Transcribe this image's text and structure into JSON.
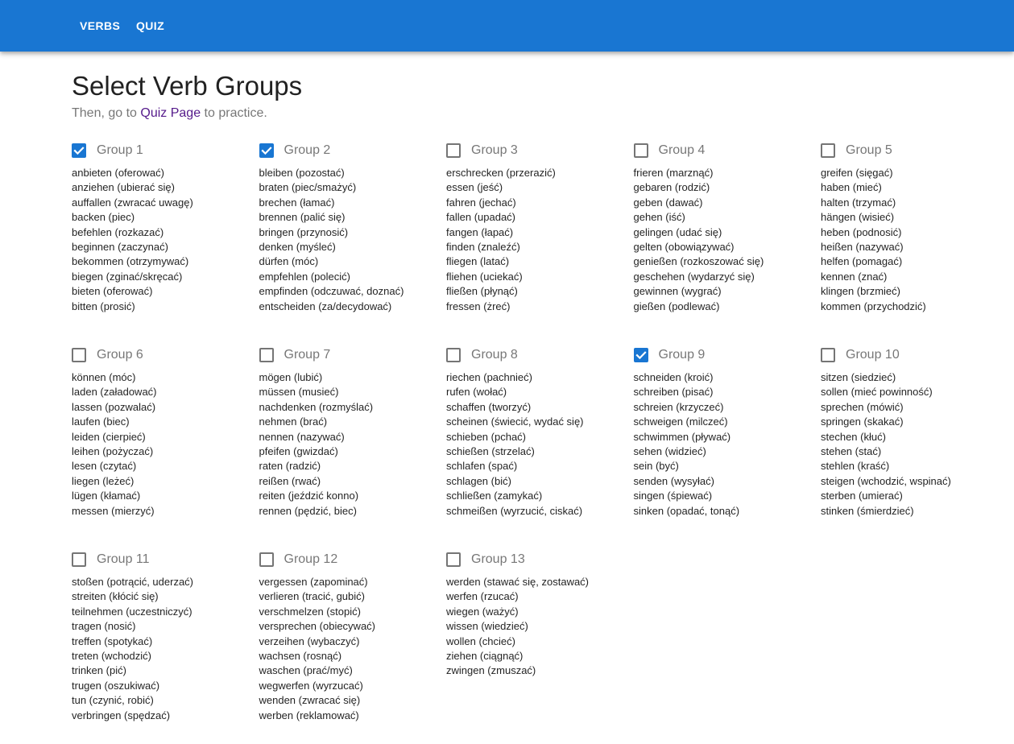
{
  "nav": {
    "verbs_label": "VERBS",
    "quiz_label": "QUIZ"
  },
  "page": {
    "title": "Select Verb Groups",
    "subtitle_before": "Then, go to ",
    "subtitle_link": "Quiz Page",
    "subtitle_after": " to practice."
  },
  "colors": {
    "appbar": "#1976d2",
    "checkbox_checked": "#1976d2",
    "link": "#551a8b"
  },
  "groups": [
    {
      "label": "Group 1",
      "checked": true,
      "verbs": [
        "anbieten (oferować)",
        "anziehen (ubierać się)",
        "auffallen (zwracać uwagę)",
        "backen (piec)",
        "befehlen (rozkazać)",
        "beginnen (zaczynać)",
        "bekommen (otrzymywać)",
        "biegen (zginać/skręcać)",
        "bieten (oferować)",
        "bitten (prosić)"
      ]
    },
    {
      "label": "Group 2",
      "checked": true,
      "verbs": [
        "bleiben (pozostać)",
        "braten (piec/smażyć)",
        "brechen (łamać)",
        "brennen (palić się)",
        "bringen (przynosić)",
        "denken (myśleć)",
        "dürfen (móc)",
        "empfehlen (polecić)",
        "empfinden (odczuwać, doznać)",
        "entscheiden (za/decydować)"
      ]
    },
    {
      "label": "Group 3",
      "checked": false,
      "verbs": [
        "erschrecken (przerazić)",
        "essen (jeść)",
        "fahren (jechać)",
        "fallen (upadać)",
        "fangen (łapać)",
        "finden (znaleźć)",
        "fliegen (latać)",
        "fliehen (uciekać)",
        "fließen (płynąć)",
        "fressen (żreć)"
      ]
    },
    {
      "label": "Group 4",
      "checked": false,
      "verbs": [
        "frieren (marznąć)",
        "gebaren (rodzić)",
        "geben (dawać)",
        "gehen (iść)",
        "gelingen (udać się)",
        "gelten (obowiązywać)",
        "genießen (rozkoszować się)",
        "geschehen (wydarzyć się)",
        "gewinnen (wygrać)",
        "gießen (podlewać)"
      ]
    },
    {
      "label": "Group 5",
      "checked": false,
      "verbs": [
        "greifen (sięgać)",
        "haben (mieć)",
        "halten (trzymać)",
        "hängen (wisieć)",
        "heben (podnosić)",
        "heißen (nazywać)",
        "helfen (pomagać)",
        "kennen (znać)",
        "klingen (brzmieć)",
        "kommen (przychodzić)"
      ]
    },
    {
      "label": "Group 6",
      "checked": false,
      "verbs": [
        "können (móc)",
        "laden (załadować)",
        "lassen (pozwalać)",
        "laufen (biec)",
        "leiden (cierpieć)",
        "leihen (pożyczać)",
        "lesen (czytać)",
        "liegen (leżeć)",
        "lügen (kłamać)",
        "messen (mierzyć)"
      ]
    },
    {
      "label": "Group 7",
      "checked": false,
      "verbs": [
        "mögen (lubić)",
        "müssen (musieć)",
        "nachdenken (rozmyślać)",
        "nehmen (brać)",
        "nennen (nazywać)",
        "pfeifen (gwizdać)",
        "raten (radzić)",
        "reißen (rwać)",
        "reiten (jeździć konno)",
        "rennen (pędzić, biec)"
      ]
    },
    {
      "label": "Group 8",
      "checked": false,
      "verbs": [
        "riechen (pachnieć)",
        "rufen (wołać)",
        "schaffen (tworzyć)",
        "scheinen (świecić, wydać się)",
        "schieben (pchać)",
        "schießen (strzelać)",
        "schlafen (spać)",
        "schlagen (bić)",
        "schließen (zamykać)",
        "schmeißen (wyrzucić, ciskać)"
      ]
    },
    {
      "label": "Group 9",
      "checked": true,
      "verbs": [
        "schneiden (kroić)",
        "schreiben (pisać)",
        "schreien (krzyczeć)",
        "schweigen (milczeć)",
        "schwimmen (pływać)",
        "sehen (widzieć)",
        "sein (być)",
        "senden (wysyłać)",
        "singen (śpiewać)",
        "sinken (opadać, tonąć)"
      ]
    },
    {
      "label": "Group 10",
      "checked": false,
      "verbs": [
        "sitzen (siedzieć)",
        "sollen (mieć powinność)",
        "sprechen (mówić)",
        "springen (skakać)",
        "stechen (kłuć)",
        "stehen (stać)",
        "stehlen (kraść)",
        "steigen (wchodzić, wspinać)",
        "sterben (umierać)",
        "stinken (śmierdzieć)"
      ]
    },
    {
      "label": "Group 11",
      "checked": false,
      "verbs": [
        "stoßen (potrącić, uderzać)",
        "streiten (kłócić się)",
        "teilnehmen (uczestniczyć)",
        "tragen (nosić)",
        "treffen (spotykać)",
        "treten (wchodzić)",
        "trinken (pić)",
        "trugen (oszukiwać)",
        "tun (czynić, robić)",
        "verbringen (spędzać)"
      ]
    },
    {
      "label": "Group 12",
      "checked": false,
      "verbs": [
        "vergessen (zapominać)",
        "verlieren (tracić, gubić)",
        "verschmelzen (stopić)",
        "versprechen (obiecywać)",
        "verzeihen (wybaczyć)",
        "wachsen (rosnąć)",
        "waschen (prać/myć)",
        "wegwerfen (wyrzucać)",
        "wenden (zwracać się)",
        "werben (reklamować)"
      ]
    },
    {
      "label": "Group 13",
      "checked": false,
      "verbs": [
        "werden (stawać się, zostawać)",
        "werfen (rzucać)",
        "wiegen (ważyć)",
        "wissen (wiedzieć)",
        "wollen (chcieć)",
        "ziehen (ciągnąć)",
        "zwingen (zmuszać)"
      ]
    }
  ]
}
